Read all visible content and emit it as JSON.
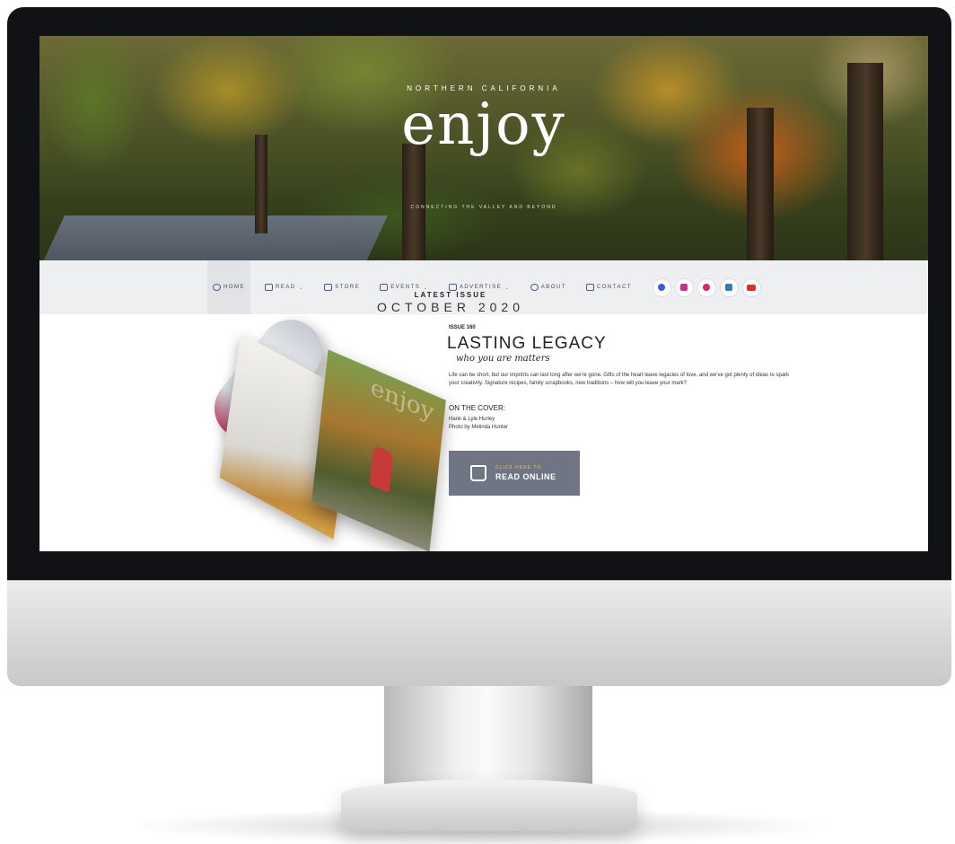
{
  "hero": {
    "kicker": "NORTHERN CALIFORNIA",
    "logo": "enjoy",
    "tagline": "CONNECTING THE VALLEY AND BEYOND"
  },
  "nav": {
    "items": [
      {
        "label": "HOME",
        "dropdown": false
      },
      {
        "label": "READ",
        "dropdown": true
      },
      {
        "label": "STORE",
        "dropdown": false
      },
      {
        "label": "EVENTS",
        "dropdown": true
      },
      {
        "label": "ADVERTISE",
        "dropdown": true
      },
      {
        "label": "ABOUT",
        "dropdown": false
      },
      {
        "label": "CONTACT",
        "dropdown": false
      }
    ],
    "dropdown_glyph": "⌄",
    "social": [
      "facebook-icon",
      "instagram-icon",
      "pinterest-icon",
      "linkedin-icon",
      "youtube-icon"
    ]
  },
  "issue": {
    "latest_label": "LATEST ISSUE",
    "month": "OCTOBER 2020",
    "number": "ISSUE 160",
    "title": "LASTING LEGACY",
    "subtitle": "who you are matters",
    "body": "Life can be short, but our imprints can last long after we're gone. Gifts of the heart leave legacies of love, and we've got plenty of ideas to spark your creativity. Signature recipes, family scrapbooks, new traditions – how will you leave your mark?",
    "cover_label": "ON THE COVER:",
    "cover_names": "Hank & Lyle Hurley",
    "cover_photo": "Photo by Melinda Hunter",
    "magazine_cover_title": "enjoy",
    "button_small": "CLICK HERE TO",
    "button_big": "READ ONLINE"
  },
  "colors": {
    "nav_bg": "#eeeff1",
    "button_bg": "#6f7584",
    "button_accent": "#e9c65a",
    "facebook": "#3b5bdb",
    "instagram": "#c13584",
    "pinterest": "#e0245e",
    "linkedin": "#2a7fc1",
    "youtube": "#e52d27"
  }
}
